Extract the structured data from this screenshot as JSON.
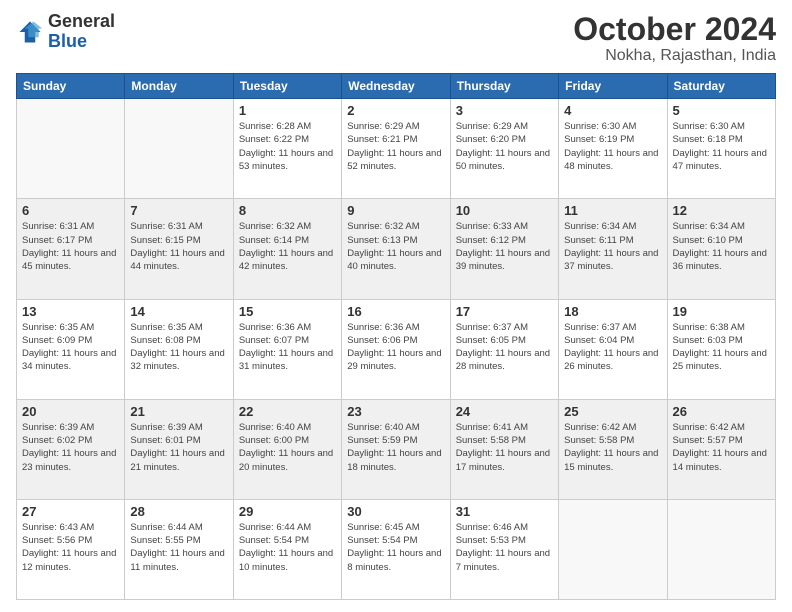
{
  "logo": {
    "general": "General",
    "blue": "Blue"
  },
  "title": {
    "month_year": "October 2024",
    "location": "Nokha, Rajasthan, India"
  },
  "days_of_week": [
    "Sunday",
    "Monday",
    "Tuesday",
    "Wednesday",
    "Thursday",
    "Friday",
    "Saturday"
  ],
  "weeks": [
    {
      "shaded": false,
      "days": [
        {
          "num": "",
          "sunrise": "",
          "sunset": "",
          "daylight": ""
        },
        {
          "num": "",
          "sunrise": "",
          "sunset": "",
          "daylight": ""
        },
        {
          "num": "1",
          "sunrise": "Sunrise: 6:28 AM",
          "sunset": "Sunset: 6:22 PM",
          "daylight": "Daylight: 11 hours and 53 minutes."
        },
        {
          "num": "2",
          "sunrise": "Sunrise: 6:29 AM",
          "sunset": "Sunset: 6:21 PM",
          "daylight": "Daylight: 11 hours and 52 minutes."
        },
        {
          "num": "3",
          "sunrise": "Sunrise: 6:29 AM",
          "sunset": "Sunset: 6:20 PM",
          "daylight": "Daylight: 11 hours and 50 minutes."
        },
        {
          "num": "4",
          "sunrise": "Sunrise: 6:30 AM",
          "sunset": "Sunset: 6:19 PM",
          "daylight": "Daylight: 11 hours and 48 minutes."
        },
        {
          "num": "5",
          "sunrise": "Sunrise: 6:30 AM",
          "sunset": "Sunset: 6:18 PM",
          "daylight": "Daylight: 11 hours and 47 minutes."
        }
      ]
    },
    {
      "shaded": true,
      "days": [
        {
          "num": "6",
          "sunrise": "Sunrise: 6:31 AM",
          "sunset": "Sunset: 6:17 PM",
          "daylight": "Daylight: 11 hours and 45 minutes."
        },
        {
          "num": "7",
          "sunrise": "Sunrise: 6:31 AM",
          "sunset": "Sunset: 6:15 PM",
          "daylight": "Daylight: 11 hours and 44 minutes."
        },
        {
          "num": "8",
          "sunrise": "Sunrise: 6:32 AM",
          "sunset": "Sunset: 6:14 PM",
          "daylight": "Daylight: 11 hours and 42 minutes."
        },
        {
          "num": "9",
          "sunrise": "Sunrise: 6:32 AM",
          "sunset": "Sunset: 6:13 PM",
          "daylight": "Daylight: 11 hours and 40 minutes."
        },
        {
          "num": "10",
          "sunrise": "Sunrise: 6:33 AM",
          "sunset": "Sunset: 6:12 PM",
          "daylight": "Daylight: 11 hours and 39 minutes."
        },
        {
          "num": "11",
          "sunrise": "Sunrise: 6:34 AM",
          "sunset": "Sunset: 6:11 PM",
          "daylight": "Daylight: 11 hours and 37 minutes."
        },
        {
          "num": "12",
          "sunrise": "Sunrise: 6:34 AM",
          "sunset": "Sunset: 6:10 PM",
          "daylight": "Daylight: 11 hours and 36 minutes."
        }
      ]
    },
    {
      "shaded": false,
      "days": [
        {
          "num": "13",
          "sunrise": "Sunrise: 6:35 AM",
          "sunset": "Sunset: 6:09 PM",
          "daylight": "Daylight: 11 hours and 34 minutes."
        },
        {
          "num": "14",
          "sunrise": "Sunrise: 6:35 AM",
          "sunset": "Sunset: 6:08 PM",
          "daylight": "Daylight: 11 hours and 32 minutes."
        },
        {
          "num": "15",
          "sunrise": "Sunrise: 6:36 AM",
          "sunset": "Sunset: 6:07 PM",
          "daylight": "Daylight: 11 hours and 31 minutes."
        },
        {
          "num": "16",
          "sunrise": "Sunrise: 6:36 AM",
          "sunset": "Sunset: 6:06 PM",
          "daylight": "Daylight: 11 hours and 29 minutes."
        },
        {
          "num": "17",
          "sunrise": "Sunrise: 6:37 AM",
          "sunset": "Sunset: 6:05 PM",
          "daylight": "Daylight: 11 hours and 28 minutes."
        },
        {
          "num": "18",
          "sunrise": "Sunrise: 6:37 AM",
          "sunset": "Sunset: 6:04 PM",
          "daylight": "Daylight: 11 hours and 26 minutes."
        },
        {
          "num": "19",
          "sunrise": "Sunrise: 6:38 AM",
          "sunset": "Sunset: 6:03 PM",
          "daylight": "Daylight: 11 hours and 25 minutes."
        }
      ]
    },
    {
      "shaded": true,
      "days": [
        {
          "num": "20",
          "sunrise": "Sunrise: 6:39 AM",
          "sunset": "Sunset: 6:02 PM",
          "daylight": "Daylight: 11 hours and 23 minutes."
        },
        {
          "num": "21",
          "sunrise": "Sunrise: 6:39 AM",
          "sunset": "Sunset: 6:01 PM",
          "daylight": "Daylight: 11 hours and 21 minutes."
        },
        {
          "num": "22",
          "sunrise": "Sunrise: 6:40 AM",
          "sunset": "Sunset: 6:00 PM",
          "daylight": "Daylight: 11 hours and 20 minutes."
        },
        {
          "num": "23",
          "sunrise": "Sunrise: 6:40 AM",
          "sunset": "Sunset: 5:59 PM",
          "daylight": "Daylight: 11 hours and 18 minutes."
        },
        {
          "num": "24",
          "sunrise": "Sunrise: 6:41 AM",
          "sunset": "Sunset: 5:58 PM",
          "daylight": "Daylight: 11 hours and 17 minutes."
        },
        {
          "num": "25",
          "sunrise": "Sunrise: 6:42 AM",
          "sunset": "Sunset: 5:58 PM",
          "daylight": "Daylight: 11 hours and 15 minutes."
        },
        {
          "num": "26",
          "sunrise": "Sunrise: 6:42 AM",
          "sunset": "Sunset: 5:57 PM",
          "daylight": "Daylight: 11 hours and 14 minutes."
        }
      ]
    },
    {
      "shaded": false,
      "days": [
        {
          "num": "27",
          "sunrise": "Sunrise: 6:43 AM",
          "sunset": "Sunset: 5:56 PM",
          "daylight": "Daylight: 11 hours and 12 minutes."
        },
        {
          "num": "28",
          "sunrise": "Sunrise: 6:44 AM",
          "sunset": "Sunset: 5:55 PM",
          "daylight": "Daylight: 11 hours and 11 minutes."
        },
        {
          "num": "29",
          "sunrise": "Sunrise: 6:44 AM",
          "sunset": "Sunset: 5:54 PM",
          "daylight": "Daylight: 11 hours and 10 minutes."
        },
        {
          "num": "30",
          "sunrise": "Sunrise: 6:45 AM",
          "sunset": "Sunset: 5:54 PM",
          "daylight": "Daylight: 11 hours and 8 minutes."
        },
        {
          "num": "31",
          "sunrise": "Sunrise: 6:46 AM",
          "sunset": "Sunset: 5:53 PM",
          "daylight": "Daylight: 11 hours and 7 minutes."
        },
        {
          "num": "",
          "sunrise": "",
          "sunset": "",
          "daylight": ""
        },
        {
          "num": "",
          "sunrise": "",
          "sunset": "",
          "daylight": ""
        }
      ]
    }
  ]
}
